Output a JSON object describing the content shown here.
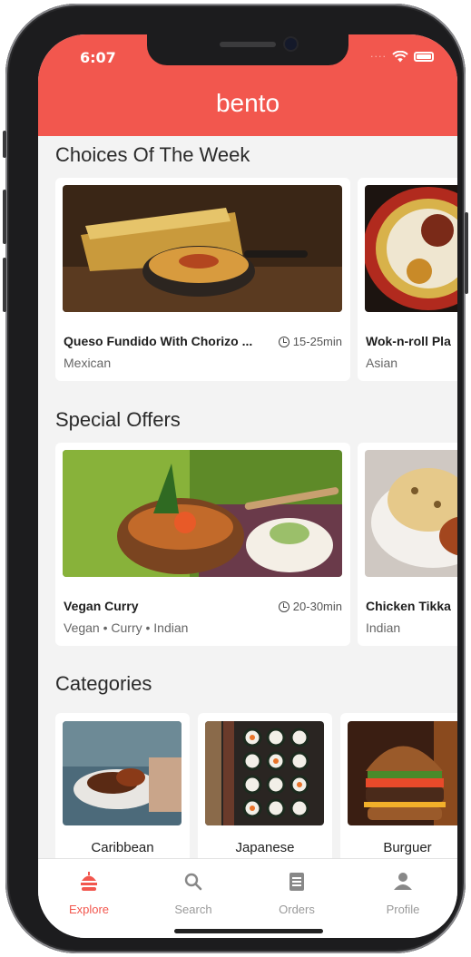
{
  "status_bar": {
    "time": "6:07"
  },
  "header": {
    "brand": "bento"
  },
  "colors": {
    "brand_red": "#f2574e",
    "background": "#f3f3f3"
  },
  "sections": {
    "choices": {
      "title": "Choices Of The Week",
      "cards": [
        {
          "name": "Queso Fundido With Chorizo ...",
          "cuisine": "Mexican",
          "time": "15-25min"
        },
        {
          "name": "Wok-n-roll Pla",
          "cuisine": "Asian"
        }
      ]
    },
    "offers": {
      "title": "Special Offers",
      "cards": [
        {
          "name": "Vegan Curry",
          "cuisine": "Vegan • Curry • Indian",
          "time": "20-30min"
        },
        {
          "name": "Chicken Tikka",
          "cuisine": "Indian"
        }
      ]
    },
    "categories": {
      "title": "Categories",
      "items": [
        {
          "label": "Caribbean"
        },
        {
          "label": "Japanese"
        },
        {
          "label": "Burguer"
        }
      ]
    }
  },
  "tabbar": {
    "tabs": [
      {
        "label": "Explore",
        "icon": "burger-icon",
        "active": true
      },
      {
        "label": "Search",
        "icon": "search-icon",
        "active": false
      },
      {
        "label": "Orders",
        "icon": "receipt-icon",
        "active": false
      },
      {
        "label": "Profile",
        "icon": "person-icon",
        "active": false
      }
    ]
  }
}
